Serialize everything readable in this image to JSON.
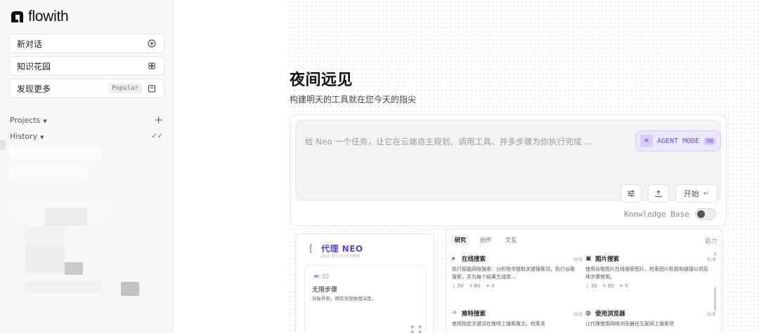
{
  "brand": {
    "name": "flowith"
  },
  "sidebar": {
    "new_chat": "新对话",
    "knowledge_garden": "知识花园",
    "discover": "发现更多",
    "discover_badge": "Popular",
    "projects": "Projects",
    "history": "History"
  },
  "main": {
    "title": "夜间远见",
    "subtitle": "构建明天的工具就在您今天的指尖",
    "prompt_placeholder": "给 Neo 一个任务，让它在云端自主规划、调用工具、并多步骤为你执行完成 ...",
    "agent_mode": "AGENT MODE",
    "agent_state": "ON",
    "start": "开始",
    "knowledge_base": "Knowledge Base"
  },
  "neo": {
    "title": "代理 NEO",
    "date": "2025 年 5 月 19 日发布",
    "number": "02",
    "heading": "无限步骤",
    "desc": "突破界限，拥有无限推理深度。"
  },
  "tools": {
    "tabs": [
      "研究",
      "创作",
      "交互"
    ],
    "ability": "能力",
    "cards": [
      {
        "name": "在线搜索",
        "tag": "标准",
        "desc": "执行智能网络搜索：分析指令提取关键搜索词，执行谷歌搜索，并为每个结果生成综...",
        "uses": "50",
        "bolt": "80",
        "link": "0"
      },
      {
        "name": "图片搜索",
        "tag": "标准",
        "desc": "使用谷歌图片在线搜索图片，检索图片标题和链接以供后续步骤使用。",
        "uses": "30",
        "bolt": "90",
        "link": "0"
      },
      {
        "name": "推特搜索",
        "tag": "标准",
        "desc": "使用指定关键词在推特上搜索推文。检索关"
      },
      {
        "name": "使用浏览器",
        "tag": "标准",
        "desc": "让代理使用网络浏览器在互联网上搜索信"
      }
    ]
  },
  "colors": {
    "accent": "#6b4fd6",
    "agent_bg": "#ece7ff"
  }
}
